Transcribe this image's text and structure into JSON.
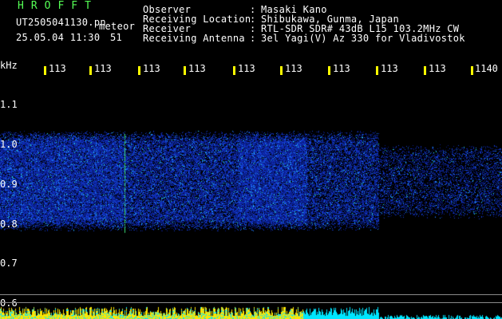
{
  "header": {
    "station_title": "HROFFT",
    "filename": "UT2505041130.pn",
    "meteor_label": "meteor",
    "datetime": "25.05.04 11:30",
    "meteor_count": "51",
    "info_keys": [
      "Observer",
      "Receiving Location",
      "Receiver",
      "Receiving Antenna"
    ],
    "info_colons": [
      ":",
      ":",
      ":",
      ":"
    ],
    "info_values": [
      "Masaki Kano",
      "Shibukawa, Gunma, Japan",
      "RTL-SDR SDR# 43dB L15 103.2MHz CW",
      "3el Yagi(V) Az 330 for Vladivostok"
    ]
  },
  "x_axis": {
    "labels": [
      "113",
      "113",
      "113",
      "113",
      "113",
      "113",
      "113",
      "113",
      "113",
      "1140"
    ]
  },
  "y_axis": {
    "unit": "kHz",
    "labels": [
      "1.1",
      "1.0",
      "0.9",
      "0.8",
      "0.7",
      "0.6"
    ]
  },
  "colors": {
    "background": "#000000",
    "tick": "#ffff00",
    "header_green": "#55ff55",
    "power_bar": "#ffff00",
    "power_bar_alt": "#00ffff",
    "noise_dim": "#0a2a9a",
    "noise_bright": "#1e90ff"
  }
}
